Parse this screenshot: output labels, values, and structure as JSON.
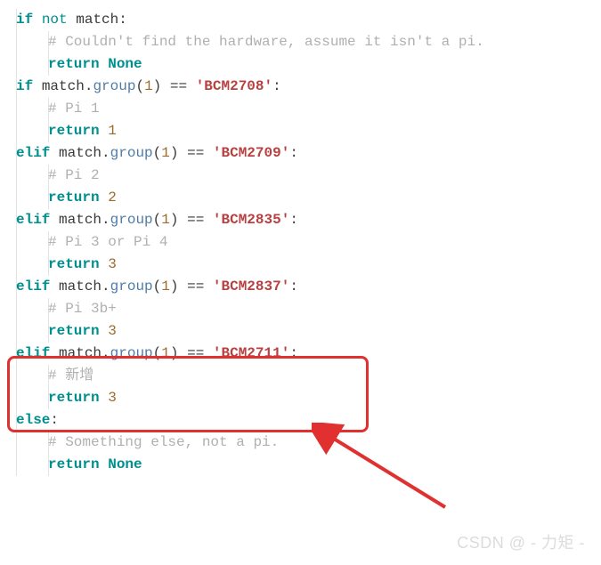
{
  "code": {
    "l01_kw_if": "if",
    "l01_kw_not": "not",
    "l01_ident": "match",
    "l01_colon": ":",
    "l02_cmt": "# Couldn't find the hardware, assume it isn't a pi.",
    "l03_return": "return",
    "l03_none": "None",
    "l04_if": "if",
    "l04_ident": "match",
    "l04_dot": ".",
    "l04_func": "group",
    "l04_lp": "(",
    "l04_num": "1",
    "l04_rp": ")",
    "l04_eq": " == ",
    "l04_str": "'BCM2708'",
    "l04_colon": ":",
    "l05_cmt": "# Pi 1",
    "l06_return": "return",
    "l06_num": "1",
    "l07_elif": "elif",
    "l07_ident": "match",
    "l07_dot": ".",
    "l07_func": "group",
    "l07_lp": "(",
    "l07_num": "1",
    "l07_rp": ")",
    "l07_eq": " == ",
    "l07_str": "'BCM2709'",
    "l07_colon": ":",
    "l08_cmt": "# Pi 2",
    "l09_return": "return",
    "l09_num": "2",
    "l10_elif": "elif",
    "l10_ident": "match",
    "l10_dot": ".",
    "l10_func": "group",
    "l10_lp": "(",
    "l10_num": "1",
    "l10_rp": ")",
    "l10_eq": " == ",
    "l10_str": "'BCM2835'",
    "l10_colon": ":",
    "l11_cmt": "# Pi 3 or Pi 4",
    "l12_return": "return",
    "l12_num": "3",
    "l13_elif": "elif",
    "l13_ident": "match",
    "l13_dot": ".",
    "l13_func": "group",
    "l13_lp": "(",
    "l13_num": "1",
    "l13_rp": ")",
    "l13_eq": " == ",
    "l13_str": "'BCM2837'",
    "l13_colon": ":",
    "l14_cmt": "# Pi 3b+",
    "l15_return": "return",
    "l15_num": "3",
    "l16_elif": "elif",
    "l16_ident": "match",
    "l16_dot": ".",
    "l16_func": "group",
    "l16_lp": "(",
    "l16_num": "1",
    "l16_rp": ")",
    "l16_eq": " == ",
    "l16_str": "'BCM2711'",
    "l16_colon": ":",
    "l17_cmt": "# 新增",
    "l18_return": "return",
    "l18_num": "3",
    "l19_else": "else",
    "l19_colon": ":",
    "l20_cmt": "# Something else, not a pi.",
    "l21_return": "return",
    "l21_none": "None"
  },
  "watermark": "CSDN @ - 力矩 -",
  "colors": {
    "highlight_border": "#e03030",
    "arrow": "#e03030"
  }
}
